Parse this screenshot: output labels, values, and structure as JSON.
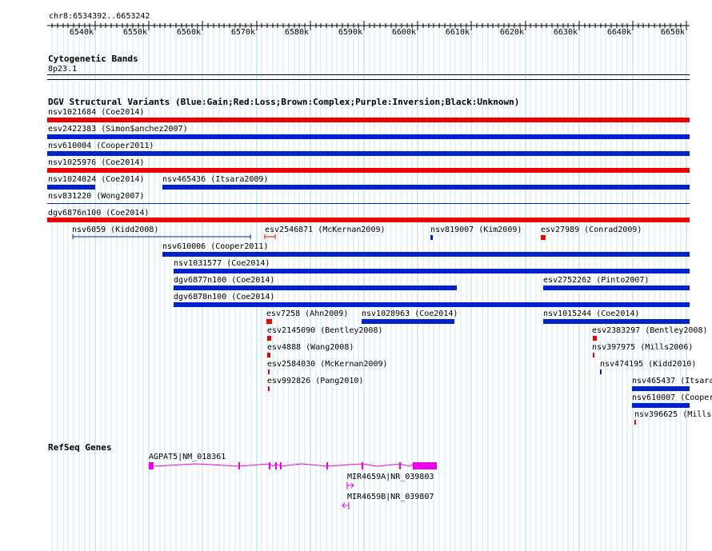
{
  "ruler": {
    "region": "chr8:6534392..6653242",
    "ticks": [
      "6540k",
      "6550k",
      "6560k",
      "6570k",
      "6580k",
      "6590k",
      "6600k",
      "6610k",
      "6620k",
      "6630k",
      "6640k",
      "6650k"
    ]
  },
  "cytobands": {
    "title": "Cytogenetic Bands",
    "band": "8p23.1"
  },
  "dgv": {
    "title": "DGV Structural Variants (Blue:Gain;Red:Loss;Brown:Complex;Purple:Inversion;Black:Unknown)",
    "labels": {
      "nsv1021684": "nsv1021684 (Coe2014)",
      "esv2422383": "esv2422383 (Simon$anchez2007)",
      "nsv610004": "nsv610004 (Cooper2011)",
      "nsv1025976": "nsv1025976 (Coe2014)",
      "nsv1024024": "nsv1024024 (Coe2014)",
      "nsv465436": "nsv465436 (Itsara2009)",
      "nsv831220": "nsv831220 (Wong2007)",
      "dgv6876n100": "dgv6876n100 (Coe2014)",
      "nsv6059": "nsv6059 (Kidd2008)",
      "esv2546871": "esv2546871 (McKernan2009)",
      "nsv819007": "nsv819007 (Kim2009)",
      "esv27989": "esv27989 (Conrad2009)",
      "nsv610006": "nsv610006 (Cooper2011)",
      "nsv1031577": "nsv1031577 (Coe2014)",
      "dgv6877n100": "dgv6877n100 (Coe2014)",
      "esv2752262": "esv2752262 (Pinto2007)",
      "dgv6878n100": "dgv6878n100 (Coe2014)",
      "esv7258": "esv7258 (Ahn2009)",
      "nsv1028963": "nsv1028963 (Coe2014)",
      "nsv1015244": "nsv1015244 (Coe2014)",
      "esv2145090": "esv2145090 (Bentley2008)",
      "esv2383297": "esv2383297 (Bentley2008)",
      "esv4888": "esv4888 (Wang2008)",
      "nsv397975": "nsv397975 (Mills2006)",
      "esv2584030": "esv2584030 (McKernan2009)",
      "nsv474195": "nsv474195 (Kidd2010)",
      "esv992826": "esv992826 (Pang2010)",
      "nsv465437": "nsv465437 (Itsara",
      "nsv610007": "nsv610007 (Cooper",
      "nsv396625": "nsv396625 (Mills"
    }
  },
  "refseq": {
    "title": "RefSeq Genes",
    "genes": {
      "agpat5": "AGPAT5|NM_018361",
      "mir4659a": "MIR4659A|NR_039803",
      "mir4659b": "MIR4659B|NR_039807"
    }
  },
  "colors": {
    "gain": "#0022cc",
    "loss": "#ee0000",
    "gene": "#ee00ee",
    "grid": "#a8d8e8"
  }
}
